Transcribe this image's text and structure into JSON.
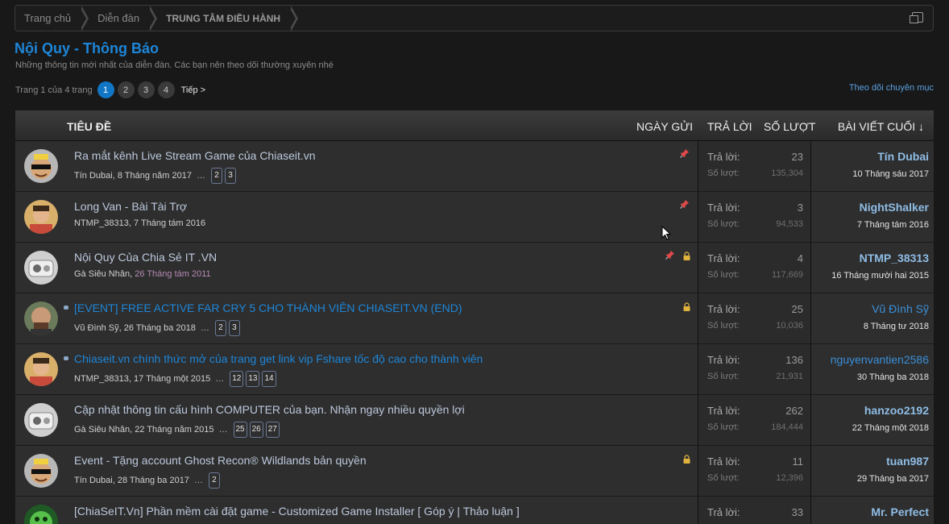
{
  "breadcrumb": [
    "Trang chủ",
    "Diễn đàn",
    "TRUNG TÂM ĐIỀU HÀNH"
  ],
  "page_title": "Nội Quy - Thông Báo",
  "page_desc": "Những thông tin mới nhất của diễn đàn. Các bạn nên theo dõi thường xuyên nhé",
  "pager": {
    "label": "Trang 1 của 4 trang",
    "pages": [
      "1",
      "2",
      "3",
      "4"
    ],
    "current": "1",
    "next": "Tiếp >"
  },
  "watch_label": "Theo dõi chuyên mục",
  "columns": {
    "title": "TIÊU ĐỀ",
    "date": "NGÀY GỬI",
    "replies": "TRẢ LỜI",
    "views": "SỐ LƯỢT",
    "last": "BÀI VIẾT CUỐI ↓"
  },
  "labels": {
    "replies": "Trả lời:",
    "views": "Số lượt:"
  },
  "colors": {
    "accent": "#1e86d8",
    "link": "#8fbde6"
  },
  "threads": [
    {
      "title": "Ra mắt kênh Live Stream Game của Chiaseit.vn",
      "author": "Tín Dubai",
      "date": "8 Tháng năm 2017",
      "pages": [
        "2",
        "3"
      ],
      "replies": "23",
      "views": "135,304",
      "last_user": "Tín Dubai",
      "last_date": "10 Tháng sáu 2017",
      "avatar": "avatar-crown"
    },
    {
      "title": "Long Van - Bài Tài Trợ",
      "author": "NTMP_38313",
      "date": "7 Tháng tám 2016",
      "pages": [],
      "replies": "3",
      "views": "94,533",
      "last_user": "NightShalker",
      "last_date": "7 Tháng tám 2016",
      "avatar": "avatar-man"
    },
    {
      "title": "Nội Quy Của Chia Sẻ IT .VN",
      "author": "Gà Siêu Nhân",
      "date": "26 Tháng tám 2011",
      "pages": [],
      "replies": "4",
      "views": "117,669",
      "last_user": "NTMP_38313",
      "last_date": "16 Tháng mười hai 2015",
      "avatar": "avatar-robot"
    },
    {
      "title": "[EVENT] FREE ACTIVE FAR CRY 5 CHO THÀNH VIÊN CHIASEIT.VN (END)",
      "author": "Vũ Đình Sỹ",
      "date": "26 Tháng ba 2018",
      "pages": [
        "2",
        "3"
      ],
      "replies": "25",
      "views": "10,036",
      "last_user": "Vũ Đình Sỹ",
      "last_date": "8 Tháng tư 2018",
      "avatar": "avatar-bald"
    },
    {
      "title": "Chiaseit.vn chính thức mở của trang get link vip Fshare tốc độ cao cho thành viên",
      "author": "NTMP_38313",
      "date": "17 Tháng một 2015",
      "pages": [
        "12",
        "13",
        "14"
      ],
      "replies": "136",
      "views": "21,931",
      "last_user": "nguyenvantien2586",
      "last_date": "30 Tháng ba 2018",
      "avatar": "avatar-man"
    },
    {
      "title": "Cập nhật thông tin cấu hình COMPUTER của bạn. Nhận ngay nhiều quyền lợi",
      "author": "Gà Siêu Nhân",
      "date": "22 Tháng năm 2015",
      "pages": [
        "25",
        "26",
        "27"
      ],
      "replies": "262",
      "views": "184,444",
      "last_user": "hanzoo2192",
      "last_date": "22 Tháng một 2018",
      "avatar": "avatar-robot"
    },
    {
      "title": "Event - Tặng account Ghost Recon® Wildlands bản quyền",
      "author": "Tín Dubai",
      "date": "28 Tháng ba 2017",
      "pages": [
        "2"
      ],
      "replies": "11",
      "views": "12,396",
      "last_user": "tuan987",
      "last_date": "29 Tháng ba 2017",
      "avatar": "avatar-crown"
    },
    {
      "title": "[ChiaSeIT.Vn] Phần mềm cài đặt game - Customized Game Installer [ Góp ý | Thảo luận ]",
      "author": "",
      "date": "",
      "pages": [],
      "replies": "33",
      "views": "",
      "last_user": "Mr. Perfect",
      "last_date": "",
      "avatar": "avatar-green"
    }
  ]
}
